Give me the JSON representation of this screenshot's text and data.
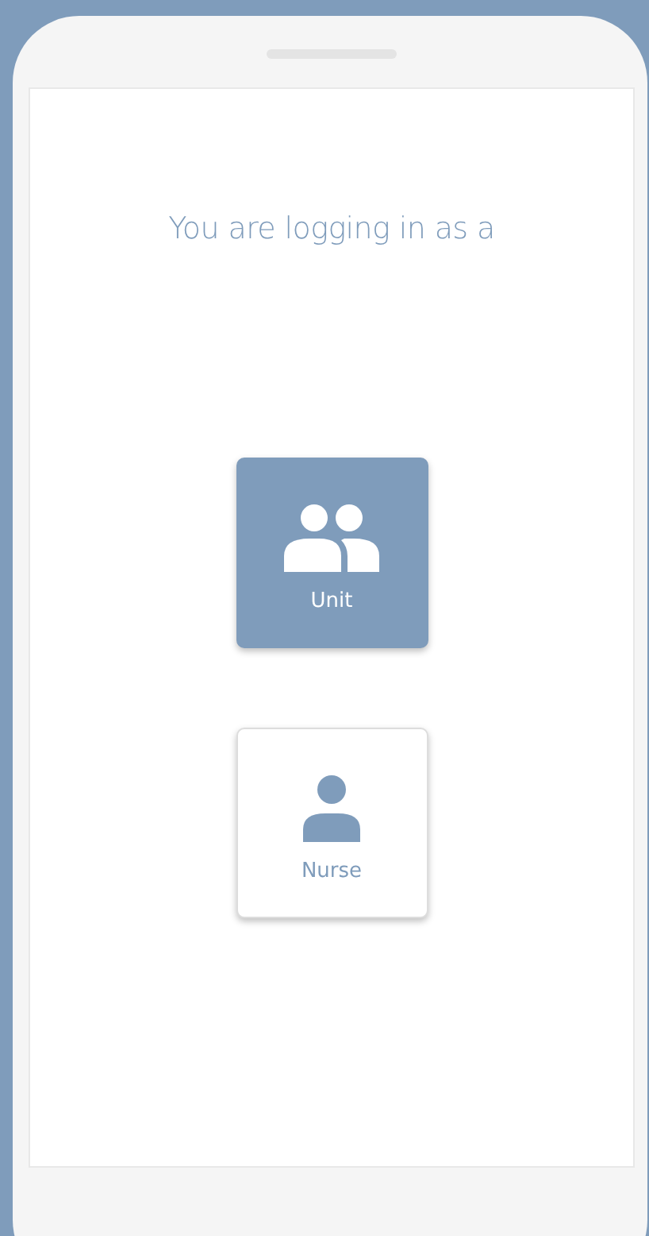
{
  "title": "You are logging in as a",
  "roles": [
    {
      "label": "Unit",
      "kind": "group",
      "selected": true
    },
    {
      "label": "Nurse",
      "kind": "single",
      "selected": false
    }
  ]
}
